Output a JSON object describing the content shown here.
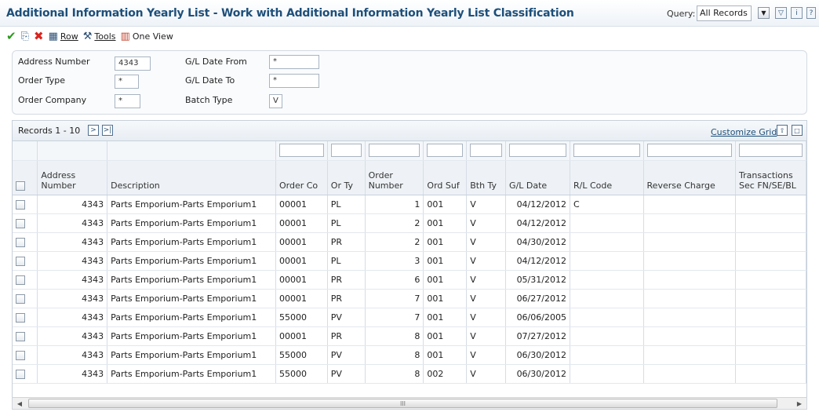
{
  "window": {
    "title": "Additional Information Yearly List - Work with Additional Information Yearly List Classification",
    "query_label": "Query:",
    "query_value": "All Records"
  },
  "toolbar": {
    "row_label": "Row",
    "tools_label": "Tools",
    "one_view_label": "One View"
  },
  "filters": {
    "address_number": {
      "label": "Address Number",
      "value": "4343"
    },
    "order_type": {
      "label": "Order Type",
      "value": "*"
    },
    "order_company": {
      "label": "Order Company",
      "value": "*"
    },
    "gl_date_from": {
      "label": "G/L Date From",
      "value": "*"
    },
    "gl_date_to": {
      "label": "G/L Date To",
      "value": "*"
    },
    "batch_type": {
      "label": "Batch Type",
      "value": "V"
    }
  },
  "grid": {
    "records_label": "Records 1 - 10",
    "customize_label": "Customize Grid",
    "scroll_marker": "III",
    "columns": [
      {
        "label": "Address Number"
      },
      {
        "label": "Description"
      },
      {
        "label": "Order Co"
      },
      {
        "label": "Or Ty"
      },
      {
        "label": "Order Number"
      },
      {
        "label": "Ord Suf"
      },
      {
        "label": "Bth Ty"
      },
      {
        "label": "G/L Date"
      },
      {
        "label": "R/L Code"
      },
      {
        "label": "Reverse Charge"
      },
      {
        "label": "Transactions Sec FN/SE/BL"
      }
    ],
    "rows": [
      {
        "addr": "4343",
        "desc": "Parts Emporium-Parts Emporium1",
        "co": "00001",
        "ty": "PL",
        "num": "1",
        "suf": "001",
        "bth": "V",
        "date": "04/12/2012",
        "rl": "C",
        "rev": "",
        "trans": ""
      },
      {
        "addr": "4343",
        "desc": "Parts Emporium-Parts Emporium1",
        "co": "00001",
        "ty": "PL",
        "num": "2",
        "suf": "001",
        "bth": "V",
        "date": "04/12/2012",
        "rl": "",
        "rev": "",
        "trans": ""
      },
      {
        "addr": "4343",
        "desc": "Parts Emporium-Parts Emporium1",
        "co": "00001",
        "ty": "PR",
        "num": "2",
        "suf": "001",
        "bth": "V",
        "date": "04/30/2012",
        "rl": "",
        "rev": "",
        "trans": ""
      },
      {
        "addr": "4343",
        "desc": "Parts Emporium-Parts Emporium1",
        "co": "00001",
        "ty": "PL",
        "num": "3",
        "suf": "001",
        "bth": "V",
        "date": "04/12/2012",
        "rl": "",
        "rev": "",
        "trans": ""
      },
      {
        "addr": "4343",
        "desc": "Parts Emporium-Parts Emporium1",
        "co": "00001",
        "ty": "PR",
        "num": "6",
        "suf": "001",
        "bth": "V",
        "date": "05/31/2012",
        "rl": "",
        "rev": "",
        "trans": ""
      },
      {
        "addr": "4343",
        "desc": "Parts Emporium-Parts Emporium1",
        "co": "00001",
        "ty": "PR",
        "num": "7",
        "suf": "001",
        "bth": "V",
        "date": "06/27/2012",
        "rl": "",
        "rev": "",
        "trans": ""
      },
      {
        "addr": "4343",
        "desc": "Parts Emporium-Parts Emporium1",
        "co": "55000",
        "ty": "PV",
        "num": "7",
        "suf": "001",
        "bth": "V",
        "date": "06/06/2005",
        "rl": "",
        "rev": "",
        "trans": ""
      },
      {
        "addr": "4343",
        "desc": "Parts Emporium-Parts Emporium1",
        "co": "00001",
        "ty": "PR",
        "num": "8",
        "suf": "001",
        "bth": "V",
        "date": "07/27/2012",
        "rl": "",
        "rev": "",
        "trans": ""
      },
      {
        "addr": "4343",
        "desc": "Parts Emporium-Parts Emporium1",
        "co": "55000",
        "ty": "PV",
        "num": "8",
        "suf": "001",
        "bth": "V",
        "date": "06/30/2012",
        "rl": "",
        "rev": "",
        "trans": ""
      },
      {
        "addr": "4343",
        "desc": "Parts Emporium-Parts Emporium1",
        "co": "55000",
        "ty": "PV",
        "num": "8",
        "suf": "002",
        "bth": "V",
        "date": "06/30/2012",
        "rl": "",
        "rev": "",
        "trans": ""
      }
    ]
  }
}
